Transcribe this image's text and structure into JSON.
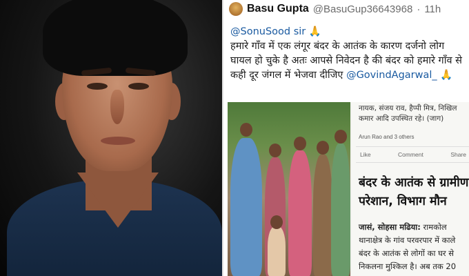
{
  "post": {
    "author_name": "Basu Gupta",
    "author_handle": "@BasuGup36643968",
    "separator": "·",
    "time": "11h",
    "mention_sonu": "@SonuSood sir",
    "pray_emoji": "🙏",
    "line2": "हमारे गाँव में एक लंगूर बंदर के आतंक के कारण दर्जनो लोग",
    "line3": "घायल हो चुके है अतः आपसे निवेदन है की बंदर को हमारे गाँव से",
    "line4_text": "कही दूर जंगल में भेजवा दीजिए ",
    "mention_govind": "@GovindAgarwal_"
  },
  "news_clip": {
    "top_line1": "नायक, संजय राव, हैप्पी मित्र, निखिल",
    "top_line2": "कमार आदि उपस्थित रहे। (जाग)",
    "reactions": "Arun Rao and 3 others",
    "like_label": "Like",
    "comment_label": "Comment",
    "share_label": "Share",
    "headline_line1": "बंदर के आतंक से ग्रामीण",
    "headline_line2": "परेशान, विभाग मौन",
    "body_dateline": "जासं, सोहसा मढिया:",
    "body_line1_rest": " रामकोल",
    "body_line2": "थानाक्षेत्र के गांव परवरपार में काले",
    "body_line3": "बंदर के आतंक से लोगों का घर से",
    "body_line4": "निकलना मुश्किल है। अब तक 20"
  }
}
